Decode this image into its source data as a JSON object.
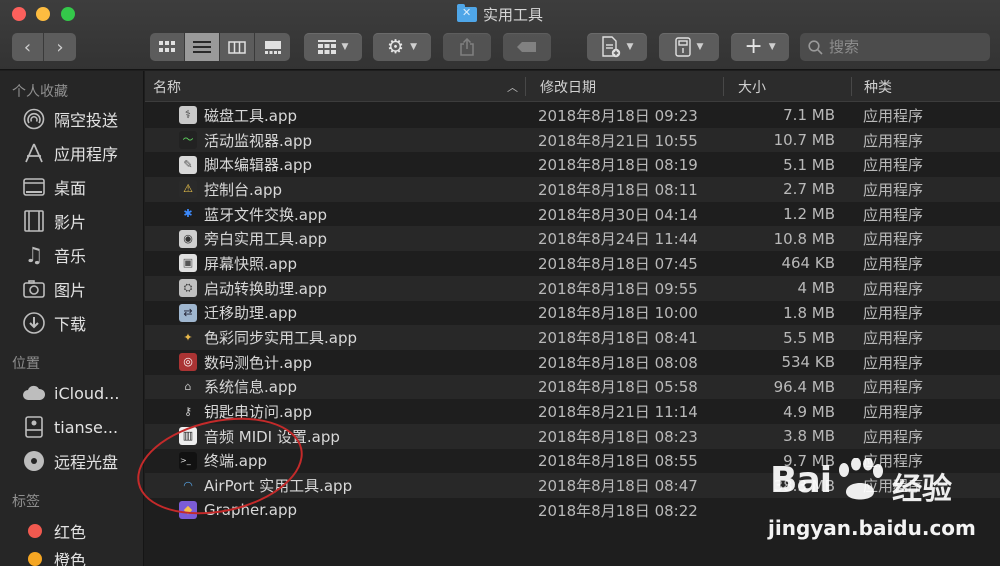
{
  "window": {
    "title": "实用工具"
  },
  "toolbar": {
    "search_placeholder": "搜索"
  },
  "sidebar": {
    "sections": [
      {
        "label": "个人收藏"
      },
      {
        "label": "位置"
      },
      {
        "label": "标签"
      }
    ],
    "favorites": [
      {
        "label": "隔空投送",
        "icon": "airdrop-icon"
      },
      {
        "label": "应用程序",
        "icon": "applications-icon"
      },
      {
        "label": "桌面",
        "icon": "desktop-icon"
      },
      {
        "label": "影片",
        "icon": "movies-icon"
      },
      {
        "label": "音乐",
        "icon": "music-icon"
      },
      {
        "label": "图片",
        "icon": "pictures-icon"
      },
      {
        "label": "下载",
        "icon": "downloads-icon"
      }
    ],
    "locations": [
      {
        "label": "iCloud...",
        "icon": "cloud-icon"
      },
      {
        "label": "tianse...",
        "icon": "disk-icon"
      },
      {
        "label": "远程光盘",
        "icon": "optical-disc-icon"
      }
    ],
    "tags": [
      {
        "label": "红色",
        "color": "#f0594f"
      },
      {
        "label": "橙色",
        "color": "#f5a623"
      }
    ]
  },
  "columns": {
    "name": "名称",
    "date": "修改日期",
    "size": "大小",
    "kind": "种类"
  },
  "files": [
    {
      "name": "磁盘工具.app",
      "date": "2018年8月18日 09:23",
      "size": "7.1 MB",
      "kind": "应用程序",
      "icon": "disk-utility-icon"
    },
    {
      "name": "活动监视器.app",
      "date": "2018年8月21日 10:55",
      "size": "10.7 MB",
      "kind": "应用程序",
      "icon": "activity-monitor-icon"
    },
    {
      "name": "脚本编辑器.app",
      "date": "2018年8月18日 08:19",
      "size": "5.1 MB",
      "kind": "应用程序",
      "icon": "script-editor-icon"
    },
    {
      "name": "控制台.app",
      "date": "2018年8月18日 08:11",
      "size": "2.7 MB",
      "kind": "应用程序",
      "icon": "console-icon"
    },
    {
      "name": "蓝牙文件交换.app",
      "date": "2018年8月30日 04:14",
      "size": "1.2 MB",
      "kind": "应用程序",
      "icon": "bluetooth-icon"
    },
    {
      "name": "旁白实用工具.app",
      "date": "2018年8月24日 11:44",
      "size": "10.8 MB",
      "kind": "应用程序",
      "icon": "voiceover-icon"
    },
    {
      "name": "屏幕快照.app",
      "date": "2018年8月18日 07:45",
      "size": "464 KB",
      "kind": "应用程序",
      "icon": "screenshot-icon"
    },
    {
      "name": "启动转换助理.app",
      "date": "2018年8月18日 09:55",
      "size": "4 MB",
      "kind": "应用程序",
      "icon": "boot-camp-icon"
    },
    {
      "name": "迁移助理.app",
      "date": "2018年8月18日 10:00",
      "size": "1.8 MB",
      "kind": "应用程序",
      "icon": "migration-icon"
    },
    {
      "name": "色彩同步实用工具.app",
      "date": "2018年8月18日 08:41",
      "size": "5.5 MB",
      "kind": "应用程序",
      "icon": "colorsync-icon"
    },
    {
      "name": "数码测色计.app",
      "date": "2018年8月18日 08:08",
      "size": "534 KB",
      "kind": "应用程序",
      "icon": "color-meter-icon"
    },
    {
      "name": "系统信息.app",
      "date": "2018年8月18日 05:58",
      "size": "96.4 MB",
      "kind": "应用程序",
      "icon": "system-info-icon"
    },
    {
      "name": "钥匙串访问.app",
      "date": "2018年8月21日 11:14",
      "size": "4.9 MB",
      "kind": "应用程序",
      "icon": "keychain-icon"
    },
    {
      "name": "音频 MIDI 设置.app",
      "date": "2018年8月18日 08:23",
      "size": "3.8 MB",
      "kind": "应用程序",
      "icon": "midi-icon"
    },
    {
      "name": "终端.app",
      "date": "2018年8月18日 08:55",
      "size": "9.7 MB",
      "kind": "应用程序",
      "icon": "terminal-icon"
    },
    {
      "name": "AirPort 实用工具.app",
      "date": "2018年8月18日 08:47",
      "size": "38.3 MB",
      "kind": "应用程序",
      "icon": "airport-icon"
    },
    {
      "name": "Grapher.app",
      "date": "2018年8月18日 08:22",
      "size": "",
      "kind": "",
      "icon": "grapher-icon"
    }
  ],
  "watermark": {
    "brand": "Bai",
    "brand_cn": "经验",
    "url": "jingyan.baidu.com"
  }
}
